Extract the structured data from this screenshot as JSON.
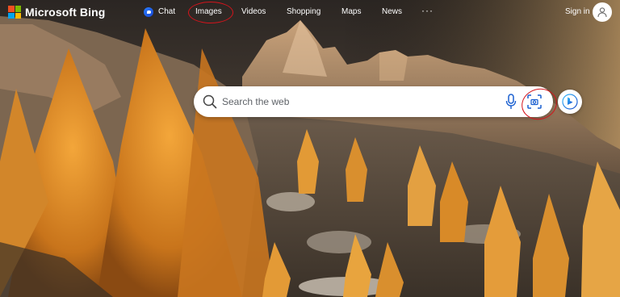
{
  "brand": {
    "name": "Microsoft Bing",
    "logo_colors": [
      "#f25022",
      "#7fba00",
      "#00a4ef",
      "#ffb900"
    ]
  },
  "nav": {
    "chat": "Chat",
    "images": "Images",
    "videos": "Videos",
    "shopping": "Shopping",
    "maps": "Maps",
    "news": "News",
    "more": "···"
  },
  "account": {
    "signin": "Sign in"
  },
  "search": {
    "placeholder": "Search the web",
    "value": ""
  },
  "annotations": {
    "highlight_color": "#d4141c"
  },
  "icons": {
    "chat": "copilot-chat-icon",
    "search": "search-icon",
    "mic": "microphone-icon",
    "visual_search": "visual-search-camera-icon",
    "copilot": "bing-copilot-icon",
    "avatar": "user-avatar-icon"
  }
}
